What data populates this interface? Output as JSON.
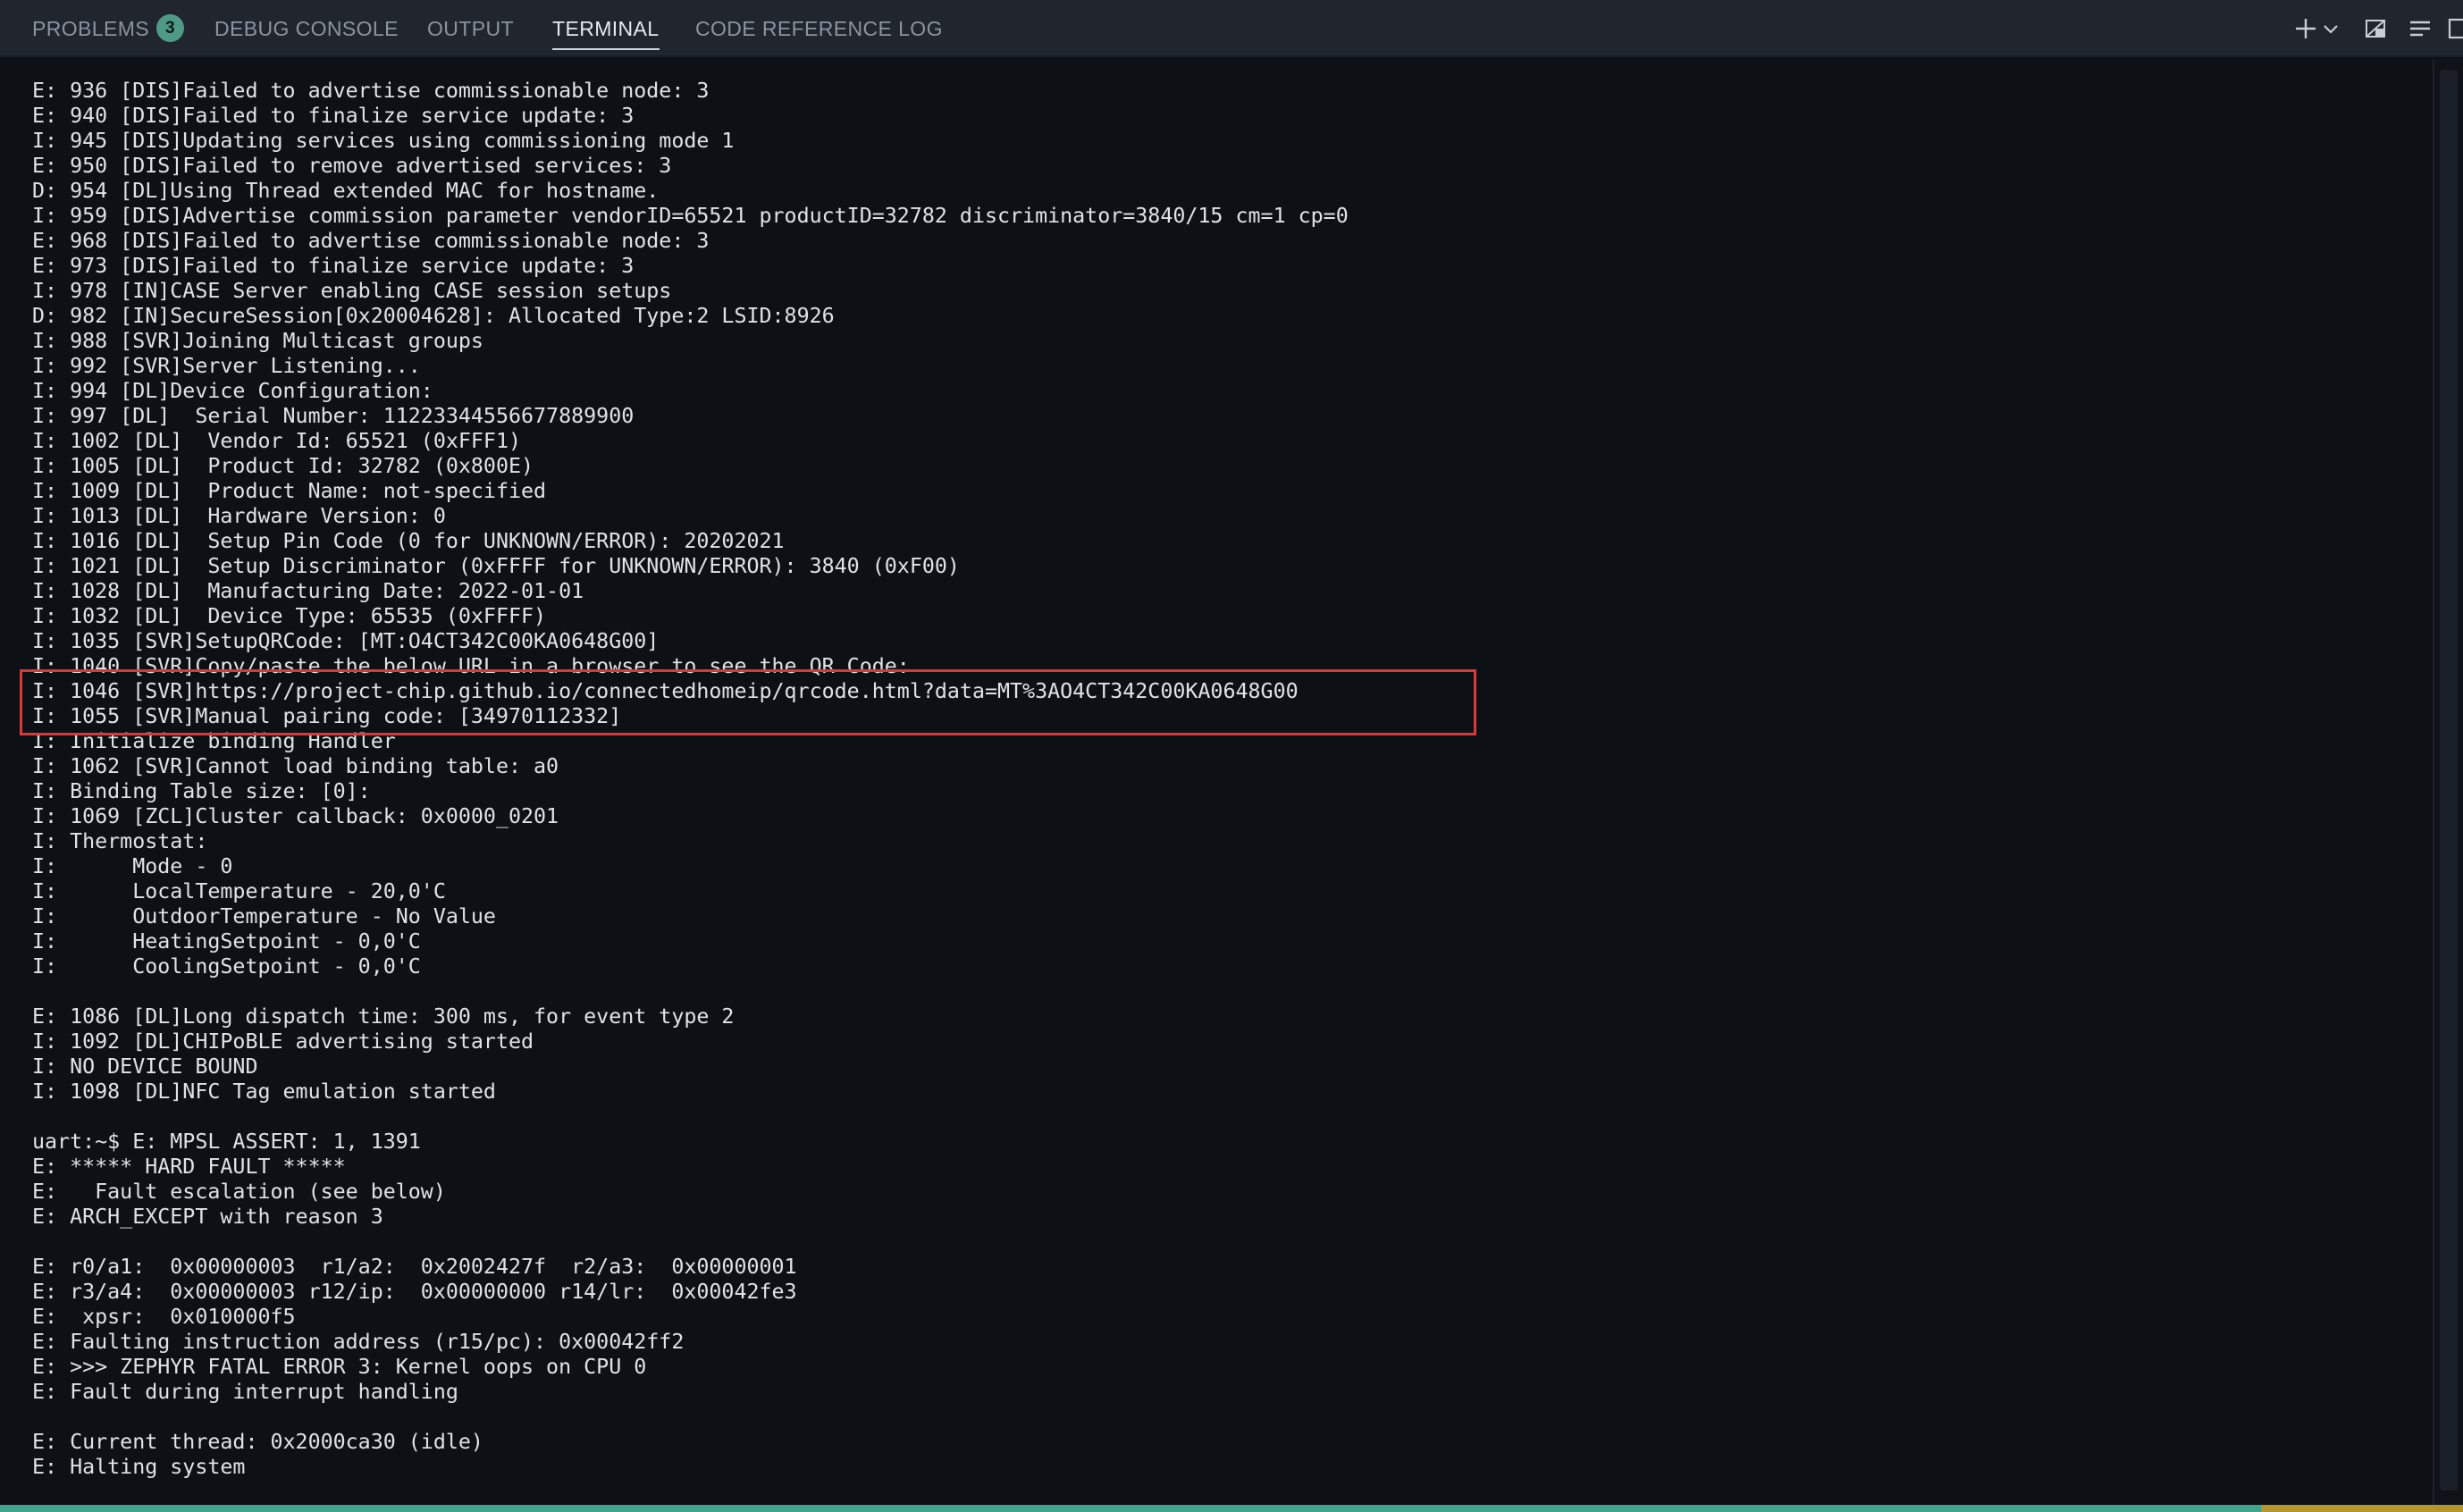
{
  "panel": {
    "tabs": [
      {
        "label": "PROBLEMS",
        "badge": "3"
      },
      {
        "label": "DEBUG CONSOLE"
      },
      {
        "label": "OUTPUT"
      },
      {
        "label": "TERMINAL"
      },
      {
        "label": "CODE REFERENCE LOG"
      }
    ],
    "active_tab": "TERMINAL",
    "toolbar_icons": [
      "plus-icon",
      "chevron-down-icon",
      "terminal-clear-icon",
      "list-icon",
      "panel-icon"
    ]
  },
  "terminal": {
    "lines": [
      "E: 936 [DIS]Failed to advertise commissionable node: 3",
      "E: 940 [DIS]Failed to finalize service update: 3",
      "I: 945 [DIS]Updating services using commissioning mode 1",
      "E: 950 [DIS]Failed to remove advertised services: 3",
      "D: 954 [DL]Using Thread extended MAC for hostname.",
      "I: 959 [DIS]Advertise commission parameter vendorID=65521 productID=32782 discriminator=3840/15 cm=1 cp=0",
      "E: 968 [DIS]Failed to advertise commissionable node: 3",
      "E: 973 [DIS]Failed to finalize service update: 3",
      "I: 978 [IN]CASE Server enabling CASE session setups",
      "D: 982 [IN]SecureSession[0x20004628]: Allocated Type:2 LSID:8926",
      "I: 988 [SVR]Joining Multicast groups",
      "I: 992 [SVR]Server Listening...",
      "I: 994 [DL]Device Configuration:",
      "I: 997 [DL]  Serial Number: 11223344556677889900",
      "I: 1002 [DL]  Vendor Id: 65521 (0xFFF1)",
      "I: 1005 [DL]  Product Id: 32782 (0x800E)",
      "I: 1009 [DL]  Product Name: not-specified",
      "I: 1013 [DL]  Hardware Version: 0",
      "I: 1016 [DL]  Setup Pin Code (0 for UNKNOWN/ERROR): 20202021",
      "I: 1021 [DL]  Setup Discriminator (0xFFFF for UNKNOWN/ERROR): 3840 (0xF00)",
      "I: 1028 [DL]  Manufacturing Date: 2022-01-01",
      "I: 1032 [DL]  Device Type: 65535 (0xFFFF)",
      "I: 1035 [SVR]SetupQRCode: [MT:O4CT342C00KA0648G00]",
      "I: 1040 [SVR]Copy/paste the below URL in a browser to see the QR Code:",
      "I: 1046 [SVR]https://project-chip.github.io/connectedhomeip/qrcode.html?data=MT%3AO4CT342C00KA0648G00",
      "I: 1055 [SVR]Manual pairing code: [34970112332]",
      "I: Initialize binding Handler",
      "I: 1062 [SVR]Cannot load binding table: a0",
      "I: Binding Table size: [0]:",
      "I: 1069 [ZCL]Cluster callback: 0x0000_0201",
      "I: Thermostat:",
      "I:      Mode - 0",
      "I:      LocalTemperature - 20,0'C",
      "I:      OutdoorTemperature - No Value",
      "I:      HeatingSetpoint - 0,0'C",
      "I:      CoolingSetpoint - 0,0'C",
      "",
      "E: 1086 [DL]Long dispatch time: 300 ms, for event type 2",
      "I: 1092 [DL]CHIPoBLE advertising started",
      "I: NO DEVICE BOUND",
      "I: 1098 [DL]NFC Tag emulation started",
      "",
      "uart:~$ E: MPSL ASSERT: 1, 1391",
      "E: ***** HARD FAULT *****",
      "E:   Fault escalation (see below)",
      "E: ARCH_EXCEPT with reason 3",
      "",
      "E: r0/a1:  0x00000003  r1/a2:  0x2002427f  r2/a3:  0x00000001",
      "E: r3/a4:  0x00000003 r12/ip:  0x00000000 r14/lr:  0x00042fe3",
      "E:  xpsr:  0x010000f5",
      "E: Faulting instruction address (r15/pc): 0x00042ff2",
      "E: >>> ZEPHYR FATAL ERROR 3: Kernel oops on CPU 0",
      "E: Fault during interrupt handling",
      "",
      "E: Current thread: 0x2000ca30 (idle)",
      "E: Halting system"
    ]
  },
  "colors": {
    "panel_background": "#20252e",
    "terminal_background": "#0d1015",
    "highlight_border": "#d83a3a",
    "badge": "#4f9a86",
    "statusbar": "#3fa58b"
  }
}
